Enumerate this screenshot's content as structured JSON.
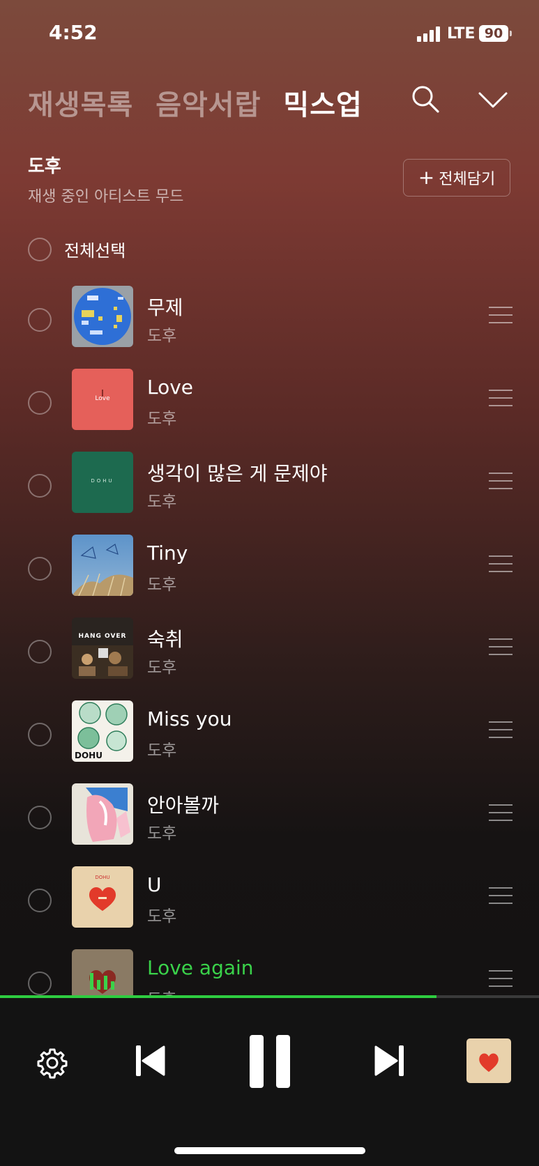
{
  "status_bar": {
    "time": "4:52",
    "network": "LTE",
    "battery": "90"
  },
  "tabs": [
    {
      "label": "재생목록",
      "active": false
    },
    {
      "label": "음악서랍",
      "active": false
    },
    {
      "label": "믹스업",
      "active": true
    }
  ],
  "mood": {
    "title": "도후",
    "subtitle": "재생 중인 아티스트 무드",
    "add_all_label": "전체담기"
  },
  "select_all_label": "전체선택",
  "songs": [
    {
      "title": "무제",
      "artist": "도후",
      "cover_label": "",
      "playing": false
    },
    {
      "title": "Love",
      "artist": "도후",
      "cover_label": "Love",
      "playing": false
    },
    {
      "title": "생각이 많은 게 문제야",
      "artist": "도후",
      "cover_label": "DOHU",
      "playing": false
    },
    {
      "title": "Tiny",
      "artist": "도후",
      "cover_label": "",
      "playing": false
    },
    {
      "title": "숙취",
      "artist": "도후",
      "cover_label": "HANG OVER",
      "playing": false
    },
    {
      "title": "Miss you",
      "artist": "도후",
      "cover_label": "DOHU",
      "playing": false
    },
    {
      "title": "안아볼까",
      "artist": "도후",
      "cover_label": "",
      "playing": false
    },
    {
      "title": "U",
      "artist": "도후",
      "cover_label": "DOHU",
      "playing": false
    },
    {
      "title": "Love again",
      "artist": "도후",
      "cover_label": "",
      "playing": true
    }
  ],
  "player": {
    "progress": 0.81,
    "accent": "#2ecc40"
  },
  "colors": {
    "playing_text": "#3ad24a"
  }
}
